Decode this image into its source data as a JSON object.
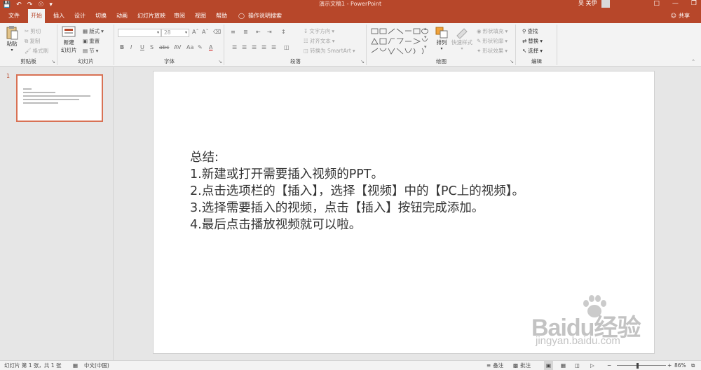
{
  "app": {
    "title": "演示文稿1 - PowerPoint",
    "user_name": "吴 美伊",
    "share_label": "共享"
  },
  "tabs": [
    {
      "label": "文件",
      "active": false
    },
    {
      "label": "开始",
      "active": true
    },
    {
      "label": "插入",
      "active": false
    },
    {
      "label": "设计",
      "active": false
    },
    {
      "label": "切换",
      "active": false
    },
    {
      "label": "动画",
      "active": false
    },
    {
      "label": "幻灯片放映",
      "active": false
    },
    {
      "label": "审阅",
      "active": false
    },
    {
      "label": "视图",
      "active": false
    },
    {
      "label": "帮助",
      "active": false
    }
  ],
  "tell_me": "操作说明搜索",
  "ribbon": {
    "clipboard": {
      "label": "剪贴板",
      "paste": "粘贴",
      "cut": "剪切",
      "copy": "复制",
      "format_painter": "格式刷"
    },
    "slides": {
      "label": "幻灯片",
      "new_slide_line1": "新建",
      "new_slide_line2": "幻灯片",
      "layout": "版式",
      "reset": "重置",
      "section": "节"
    },
    "font": {
      "label": "字体",
      "font_name": "",
      "font_size": "28"
    },
    "paragraph": {
      "label": "段落",
      "text_direction": "文字方向",
      "align_text": "对齐文本",
      "convert_smartart": "转换为 SmartArt"
    },
    "drawing": {
      "label": "绘图",
      "arrange": "排列",
      "quick_styles": "快速样式",
      "shape_fill": "形状填充",
      "shape_outline": "形状轮廓",
      "shape_effects": "形状效果"
    },
    "editing": {
      "label": "编辑",
      "find": "查找",
      "replace": "替换",
      "select": "选择"
    }
  },
  "thumbnail": {
    "slide_number": "1"
  },
  "slide": {
    "lines": [
      "总结:",
      "1.新建或打开需要插入视频的PPT。",
      "2.点击选项栏的【插入】，选择【视频】中的【PC上的视频】。",
      "3.选择需要插入的视频，点击【插入】按钮完成添加。",
      "4.最后点击播放视频就可以啦。"
    ]
  },
  "watermark": {
    "brand": "Baidu经验",
    "url": "jingyan.baidu.com"
  },
  "status": {
    "slide_info": "幻灯片 第 1 张，共 1 张",
    "language": "中文(中国)",
    "notes": "备注",
    "comments": "批注",
    "zoom": "86%"
  },
  "colors": {
    "accent": "#b7472a",
    "ribbon_bg": "#f3f3f3",
    "workspace_bg": "#e6e6e6"
  }
}
